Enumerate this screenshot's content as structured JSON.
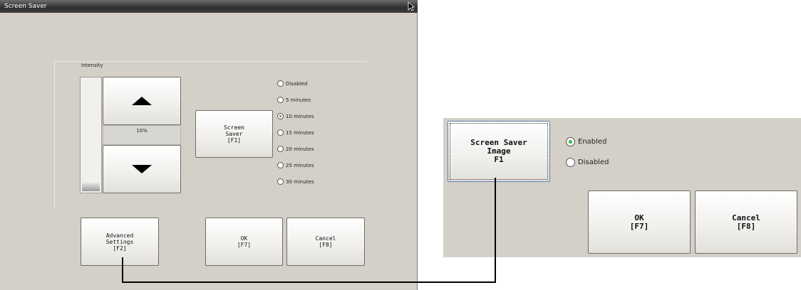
{
  "dialog": {
    "title": "Screen Saver",
    "intensity_label": "Intensity",
    "intensity_value": "10%",
    "intensity_level": 0.1,
    "screen_saver_button": "Screen\nSaver\n[F1]",
    "advanced_button": "Advanced\nSettings\n[F2]",
    "ok_button": "OK\n[F7]",
    "cancel_button": "Cancel\n[F8]",
    "timeout_options": [
      "Disabled",
      "5 minutes",
      "10 minutes",
      "15 minutes",
      "20 minutes",
      "25 minutes",
      "30 minutes"
    ],
    "selected_timeout": "10 minutes"
  },
  "image_panel": {
    "screen_saver_image_button": "Screen Saver\nImage\nF1",
    "options": [
      "Enabled",
      "Disabled"
    ],
    "selected": "Enabled",
    "ok_button": "OK\n[F7]",
    "cancel_button": "Cancel\n[F8]"
  },
  "icons": {
    "increase": "arrow-up-icon",
    "decrease": "arrow-down-icon",
    "cursor": "mouse-cursor-icon"
  },
  "colors": {
    "dialog_bg": "#d4d0c8",
    "title_bar": "#2f2f2f",
    "selected_radio_accent": "#2fbf3f"
  }
}
